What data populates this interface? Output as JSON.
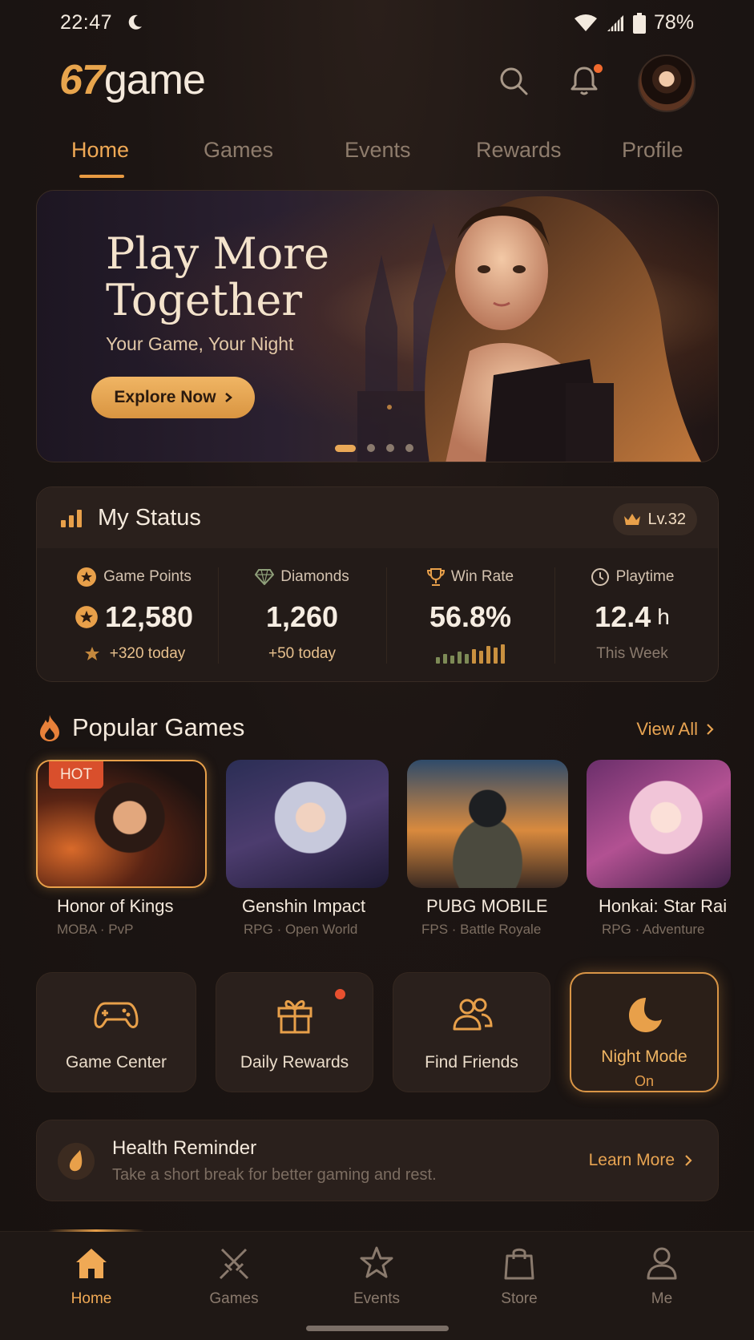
{
  "status_bar": {
    "time": "22:47",
    "battery": "78%",
    "icons": [
      "moon-icon",
      "wifi-icon",
      "signal-icon",
      "battery-icon"
    ]
  },
  "header": {
    "logo_number": "67",
    "logo_word": "game",
    "notification_dot": true,
    "icons": [
      "search-icon",
      "bell-icon",
      "avatar"
    ]
  },
  "tabs": [
    {
      "label": "Home",
      "active": true
    },
    {
      "label": "Games",
      "active": false
    },
    {
      "label": "Events",
      "active": false
    },
    {
      "label": "Rewards",
      "active": false
    },
    {
      "label": "Profile",
      "active": false
    }
  ],
  "hero": {
    "title": "Play More Together",
    "subtitle": "Your Game, Your Night",
    "button_label": "Explore Now",
    "slides": 4,
    "active_slide": 1
  },
  "my_status": {
    "title": "My Status",
    "level": "Lv.32",
    "stats": [
      {
        "label": "Game Points",
        "value": "12,580",
        "unit": "",
        "sub": "+320 today",
        "icon": "star-icon"
      },
      {
        "label": "Diamonds",
        "value": "1,260",
        "unit": "",
        "sub": "+50 today",
        "icon": "diamond-icon"
      },
      {
        "label": "Win Rate",
        "value": "56.8%",
        "unit": "",
        "sub": "",
        "icon": "trophy-icon"
      },
      {
        "label": "Playtime",
        "value": "12.4",
        "unit": "h",
        "sub": "This Week",
        "icon": "clock-icon"
      }
    ]
  },
  "popular": {
    "title": "Popular Games",
    "view_all": "View All",
    "hot_badge": "HOT",
    "games": [
      {
        "name": "Honor of Kings",
        "genre": "MOBA",
        "tag": "PvP",
        "hot": true
      },
      {
        "name": "Genshin Impact",
        "genre": "RPG",
        "tag": "Open World",
        "hot": false
      },
      {
        "name": "PUBG MOBILE",
        "genre": "FPS",
        "tag": "Battle Royale",
        "hot": false
      },
      {
        "name": "Honkai: Star Rai",
        "genre": "RPG",
        "tag": "Adventure",
        "hot": false
      }
    ]
  },
  "quick_actions": [
    {
      "label": "Game Center",
      "icon": "gamepad-icon",
      "sub": ""
    },
    {
      "label": "Daily Rewards",
      "icon": "gift-icon",
      "sub": "",
      "dot": true
    },
    {
      "label": "Find Friends",
      "icon": "friends-icon",
      "sub": ""
    },
    {
      "label": "Night Mode",
      "icon": "moon-icon",
      "sub": "On",
      "active": true
    }
  ],
  "health": {
    "title": "Health Reminder",
    "text": "Take a short break for better gaming and rest.",
    "link": "Learn More"
  },
  "bottom_nav": [
    {
      "label": "Home",
      "icon": "home-icon",
      "active": true
    },
    {
      "label": "Games",
      "icon": "swords-icon",
      "active": false
    },
    {
      "label": "Events",
      "icon": "star-icon",
      "active": false
    },
    {
      "label": "Store",
      "icon": "bag-icon",
      "active": false
    },
    {
      "label": "Me",
      "icon": "person-icon",
      "active": false
    }
  ],
  "colors": {
    "accent": "#e8a04a",
    "background": "#1c1513",
    "card": "#2a201c",
    "hot": "#d94f2c"
  }
}
